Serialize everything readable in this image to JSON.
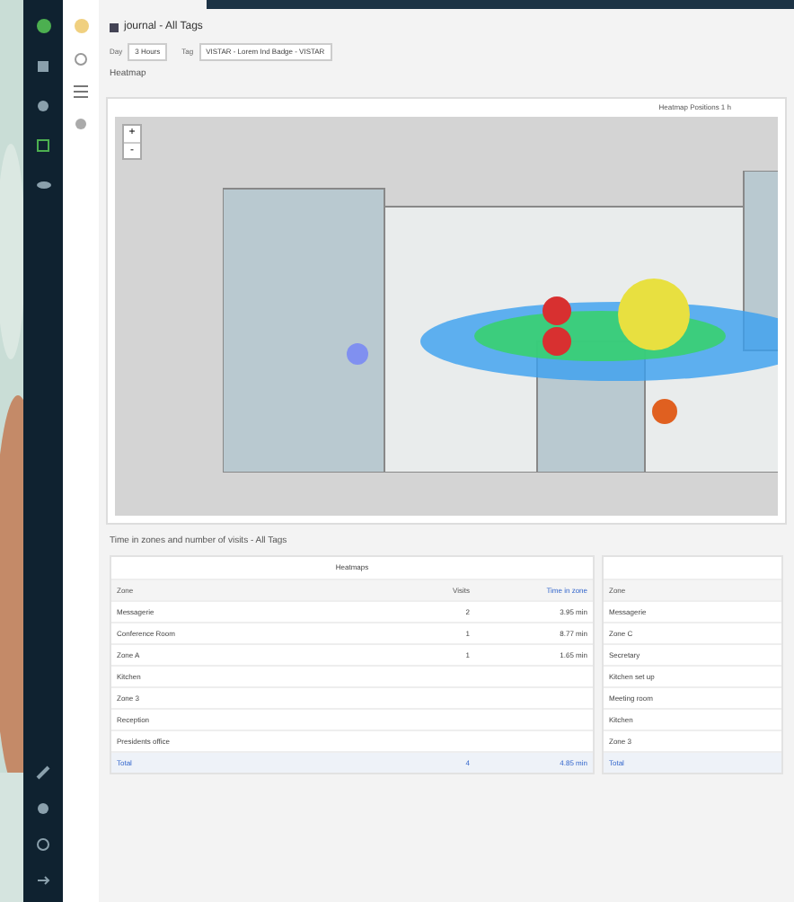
{
  "page": {
    "title": "journal - All Tags",
    "filters": [
      {
        "label": "Day",
        "value": "3 Hours"
      },
      {
        "label": "Tag",
        "value": "VISTAR - Lorem Ind Badge - VISTAR"
      }
    ]
  },
  "heatmap": {
    "title": "Heatmap",
    "legend": "Heatmap Positions 1 h",
    "zoom_in": "+",
    "zoom_out": "-"
  },
  "table_section": {
    "title": "Time in zones and number of visits - All Tags",
    "group": "Heatmaps",
    "columns": [
      "Zone",
      "Visits",
      "Time in zone"
    ],
    "rows": [
      [
        "Messagerie",
        "2",
        "3.95 min"
      ],
      [
        "Conference Room",
        "1",
        "8.77 min"
      ],
      [
        "Zone A",
        "1",
        "1.65 min"
      ],
      [
        "Kitchen",
        "",
        ""
      ],
      [
        "Zone 3",
        "",
        ""
      ],
      [
        "Reception",
        "",
        ""
      ],
      [
        "Presidents office",
        "",
        ""
      ]
    ],
    "total": [
      "Total",
      "4",
      "4.85 min"
    ],
    "side_column": "Zone",
    "side_rows": [
      "Messagerie",
      "Zone C",
      "Secretary",
      "Kitchen set up",
      "Meeting room",
      "Kitchen",
      "Zone 3"
    ],
    "side_total": "Total"
  }
}
